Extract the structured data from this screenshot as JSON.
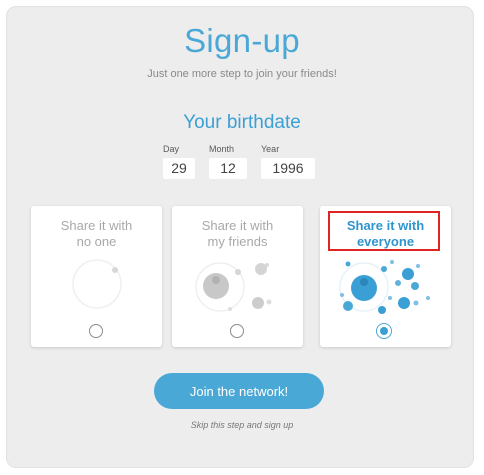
{
  "header": {
    "title": "Sign-up",
    "subtitle": "Just one more step to join your friends!"
  },
  "birthdate": {
    "title": "Your birthdate",
    "fields": [
      {
        "label": "Day",
        "value": "29"
      },
      {
        "label": "Month",
        "value": "12"
      },
      {
        "label": "Year",
        "value": "1996"
      }
    ]
  },
  "sharing_options": [
    {
      "label_line1": "Share it with",
      "label_line2": "no one",
      "selected": false
    },
    {
      "label_line1": "Share it with",
      "label_line2": "my friends",
      "selected": false
    },
    {
      "label_line1": "Share it with",
      "label_line2": "everyone",
      "selected": true
    }
  ],
  "actions": {
    "join_label": "Join the network!",
    "skip_label": "Skip this step and sign up"
  },
  "colors": {
    "accent": "#4aa8d6",
    "highlight": "#e02424"
  }
}
